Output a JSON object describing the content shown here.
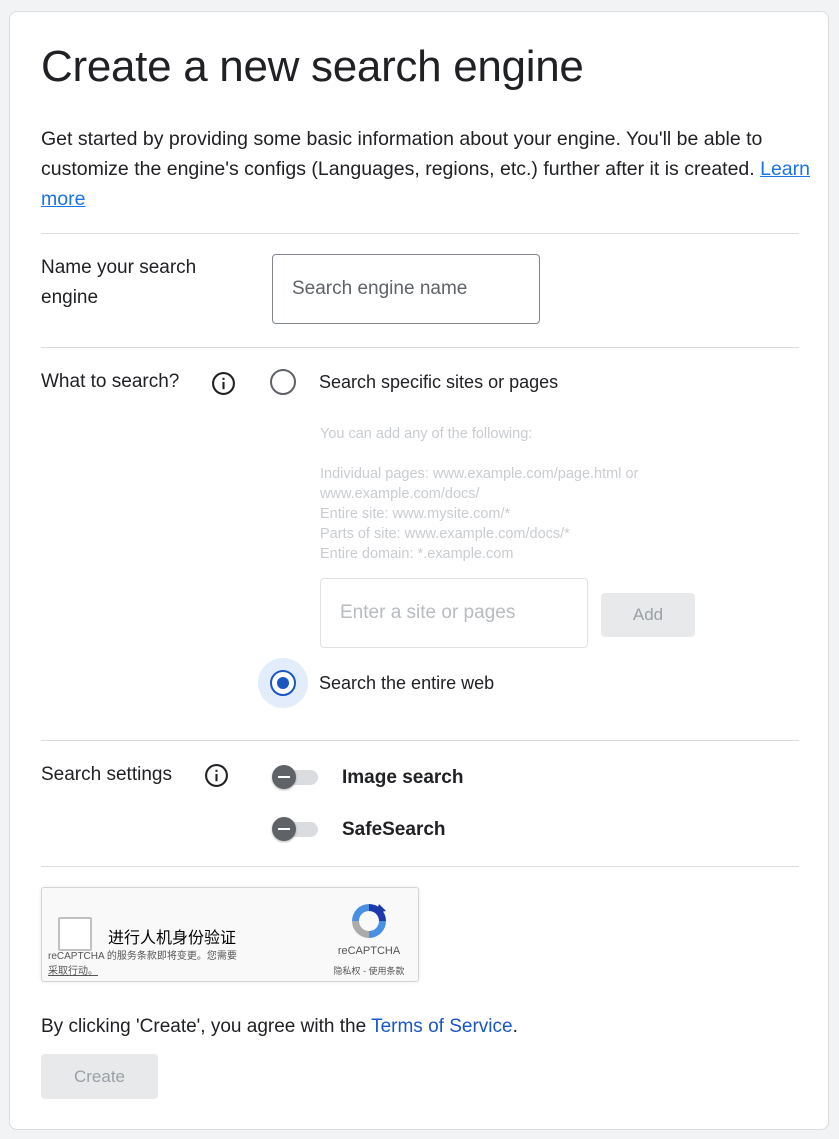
{
  "page": {
    "title": "Create a new search engine",
    "intro": "Get started by providing some basic information about your engine. You'll be able to customize the engine's configs (Languages, regions, etc.) further after it is created.",
    "learn_more": "Learn more"
  },
  "name_section": {
    "label": "Name your search engine",
    "placeholder": "Search engine name",
    "value": ""
  },
  "what_section": {
    "label": "What to search?",
    "info_icon": "info-icon",
    "option_specific": "Search specific sites or pages",
    "option_specific_selected": false,
    "hint_heading": "You can add any of the following:",
    "hint_lines": [
      "Individual pages: www.example.com/page.html or www.example.com/docs/",
      "Entire site: www.mysite.com/*",
      "Parts of site: www.example.com/docs/*",
      "Entire domain: *.example.com"
    ],
    "site_placeholder": "Enter a site or pages",
    "add_label": "Add",
    "option_web": "Search the entire web",
    "option_web_selected": true
  },
  "settings_section": {
    "label": "Search settings",
    "info_icon": "info-icon",
    "toggles": [
      {
        "label": "Image search",
        "on": false
      },
      {
        "label": "SafeSearch",
        "on": false
      }
    ]
  },
  "recaptcha": {
    "label": "进行人机身份验证",
    "notice": "reCAPTCHA 的服务条款即将变更。您需要",
    "notice_link": "采取行动。",
    "brand": "reCAPTCHA",
    "links": "隐私权 - 使用条款"
  },
  "footer": {
    "tos_prefix": "By clicking 'Create', you agree with the ",
    "tos_link": "Terms of Service",
    "tos_suffix": ".",
    "create_label": "Create"
  },
  "colors": {
    "accent": "#1a57c3",
    "link": "#1a73e8",
    "text": "#202124",
    "disabled_bg": "#e8e9eb",
    "disabled_text": "#9aa0a6"
  }
}
